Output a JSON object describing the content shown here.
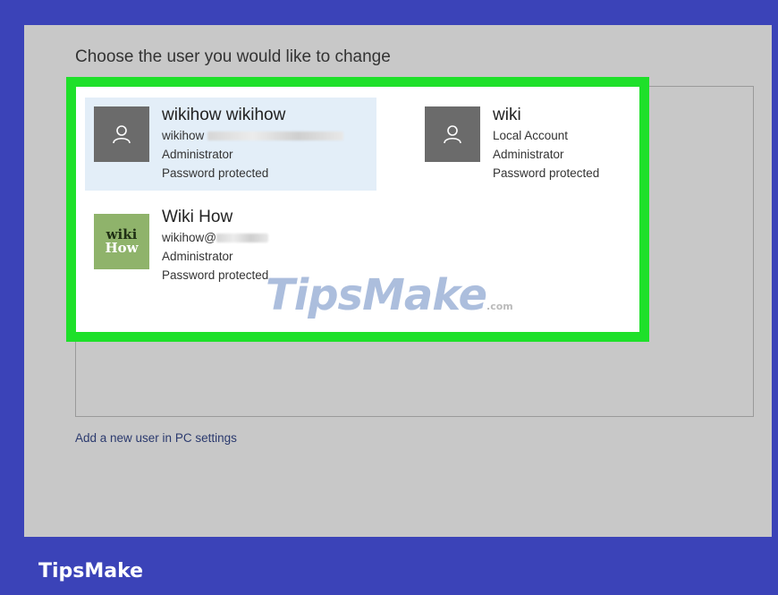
{
  "heading": "Choose the user you would like to change",
  "users": [
    {
      "name": "wikihow wikihow",
      "email": "wikihow",
      "role": "Administrator",
      "status": "Password protected",
      "icon": "user-silhouette-icon",
      "selected": true
    },
    {
      "name": "wiki",
      "email": "Local Account",
      "role": "Administrator",
      "status": "Password protected",
      "icon": "user-silhouette-icon",
      "selected": false
    },
    {
      "name": "Wiki How",
      "email": "wikihow@",
      "role": "Administrator",
      "status": "Password protected",
      "icon": "wikihow-logo",
      "avatar_text": [
        "wiki",
        "How"
      ],
      "selected": false
    }
  ],
  "add_user_link": "Add a new user in PC settings",
  "watermark": {
    "main": "TipsMake",
    "suffix": ".com"
  },
  "brand": "TipsMake",
  "colors": {
    "frame": "#3b43b8",
    "panel": "#c8c8c8",
    "highlight_border": "#1ee02a",
    "selected_tile": "#e3eef8"
  }
}
